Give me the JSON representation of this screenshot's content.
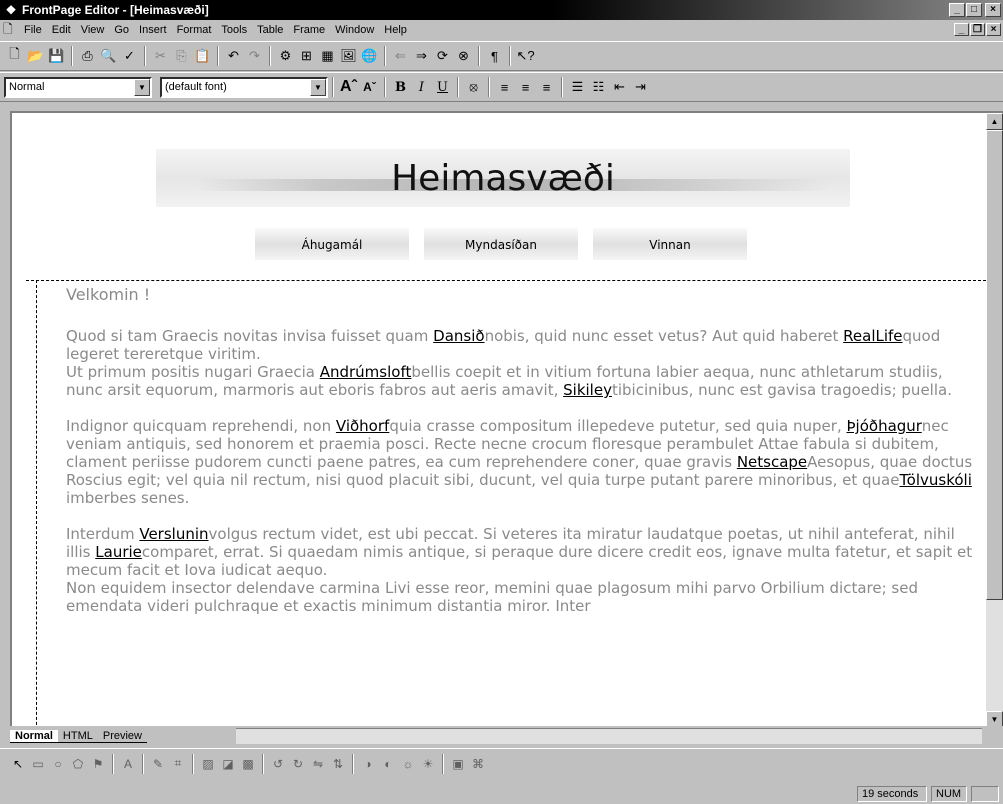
{
  "window": {
    "title": "FrontPage Editor - [Heimasvæði]"
  },
  "menu": [
    "File",
    "Edit",
    "View",
    "Go",
    "Insert",
    "Format",
    "Tools",
    "Table",
    "Frame",
    "Window",
    "Help"
  ],
  "format_toolbar": {
    "style_value": "Normal",
    "font_value": "(default font)"
  },
  "page": {
    "banner": "Heimasvæði",
    "nav": [
      "Áhugamál",
      "Myndasíðan",
      "Vinnan"
    ],
    "welcome": "Velkomin !",
    "p1_a": "Quod si tam Graecis novitas invisa fuisset quam ",
    "p1_link1": "Dansið",
    "p1_b": "nobis, quid nunc esset vetus? Aut quid haberet ",
    "p1_link2": "RealLife",
    "p1_c": "quod legeret tereretque viritim.",
    "p1_d": "Ut primum positis nugari Graecia ",
    "p1_link3": "Andrúmsloft",
    "p1_e": "bellis coepit et in vitium fortuna labier aequa, nunc athletarum studiis, nunc arsit equorum, marmoris aut eboris fabros aut aeris amavit, ",
    "p1_link4": "Sikiley",
    "p1_f": "tibicinibus, nunc est gavisa tragoedis; puella.",
    "p2_a": "Indignor quicquam reprehendi, non ",
    "p2_link1": "Viðhorf",
    "p2_b": "quia crasse compositum illepedeve putetur, sed quia nuper, ",
    "p2_link2": "Þjóðhagur",
    "p2_c": "nec veniam antiquis, sed honorem et praemia posci. Recte necne crocum floresque perambulet Attae fabula si dubitem, clament periisse pudorem cuncti paene patres, ea cum reprehendere coner, quae gravis ",
    "p2_link3": "Netscape",
    "p2_d": "Aesopus, quae doctus Roscius egit; vel quia nil rectum, nisi quod placuit sibi, ducunt, vel quia turpe putant parere minoribus, et quae",
    "p2_link4": "Tölvuskóli",
    "p2_e": " imberbes senes.",
    "p3_a": "Interdum ",
    "p3_link1": "Verslunin",
    "p3_b": "volgus rectum videt, est ubi peccat. Si veteres ita miratur laudatque poetas, ut nihil anteferat, nihil illis ",
    "p3_link2": "Laurie",
    "p3_c": "comparet, errat. Si quaedam nimis antique, si peraque dure dicere credit eos, ignave multa fatetur, et sapit et mecum facit et Iova iudicat aequo.",
    "p3_d": "Non equidem insector delendave carmina Livi esse reor, memini quae plagosum mihi parvo Orbilium dictare; sed emendata videri pulchraque et exactis minimum distantia miror. Inter"
  },
  "tabs": [
    "Normal",
    "HTML",
    "Preview"
  ],
  "status": {
    "time": "19 seconds",
    "num": "NUM"
  }
}
